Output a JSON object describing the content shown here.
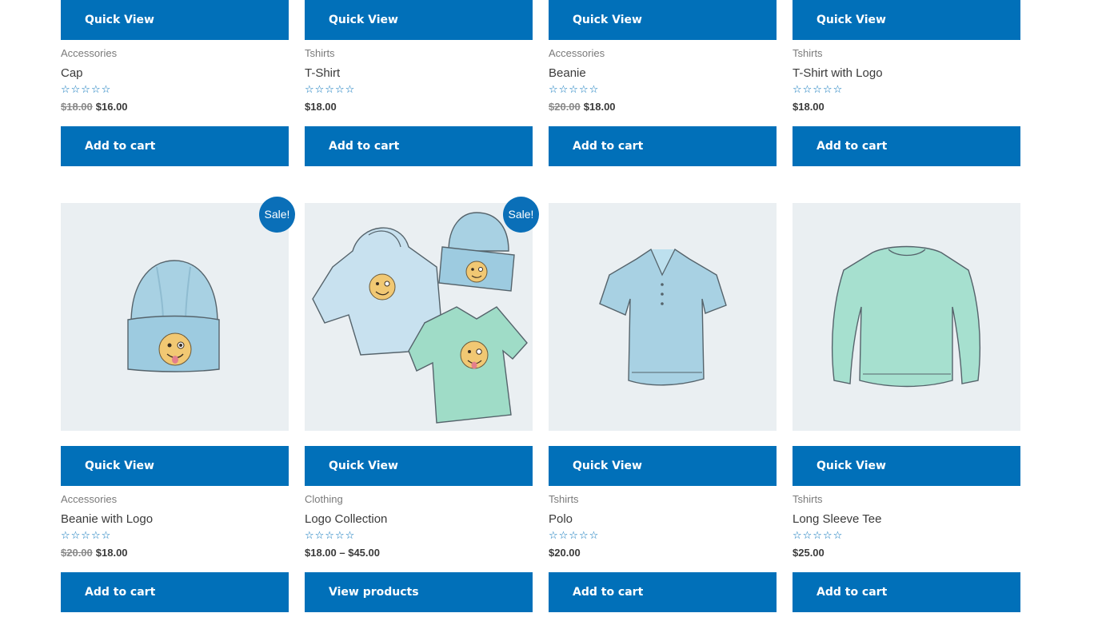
{
  "colors": {
    "accent": "#0170b9",
    "badge": "#0a6fb8",
    "thumb_bg": "#eaeff2"
  },
  "rating_icon": "empty-five-star-rating",
  "row1": [
    {
      "quick_view": "Quick View",
      "category": "Accessories",
      "title": "Cap",
      "old_price": "$18.00",
      "price": "$16.00",
      "cta": "Add to cart"
    },
    {
      "quick_view": "Quick View",
      "category": "Tshirts",
      "title": "T-Shirt",
      "old_price": "",
      "price": "$18.00",
      "cta": "Add to cart"
    },
    {
      "quick_view": "Quick View",
      "category": "Accessories",
      "title": "Beanie",
      "old_price": "$20.00",
      "price": "$18.00",
      "cta": "Add to cart"
    },
    {
      "quick_view": "Quick View",
      "category": "Tshirts",
      "title": "T-Shirt with Logo",
      "old_price": "",
      "price": "$18.00",
      "cta": "Add to cart"
    }
  ],
  "row2": [
    {
      "badge": "Sale!",
      "image": "beanie-with-logo-illustration",
      "quick_view": "Quick View",
      "category": "Accessories",
      "title": "Beanie with Logo",
      "old_price": "$20.00",
      "price": "$18.00",
      "cta": "Add to cart"
    },
    {
      "badge": "Sale!",
      "image": "logo-collection-illustration",
      "quick_view": "Quick View",
      "category": "Clothing",
      "title": "Logo Collection",
      "old_price": "",
      "price": "$18.00 – $45.00",
      "cta": "View products"
    },
    {
      "badge": "",
      "image": "polo-illustration",
      "quick_view": "Quick View",
      "category": "Tshirts",
      "title": "Polo",
      "old_price": "",
      "price": "$20.00",
      "cta": "Add to cart"
    },
    {
      "badge": "",
      "image": "long-sleeve-tee-illustration",
      "quick_view": "Quick View",
      "category": "Tshirts",
      "title": "Long Sleeve Tee",
      "old_price": "",
      "price": "$25.00",
      "cta": "Add to cart"
    }
  ]
}
